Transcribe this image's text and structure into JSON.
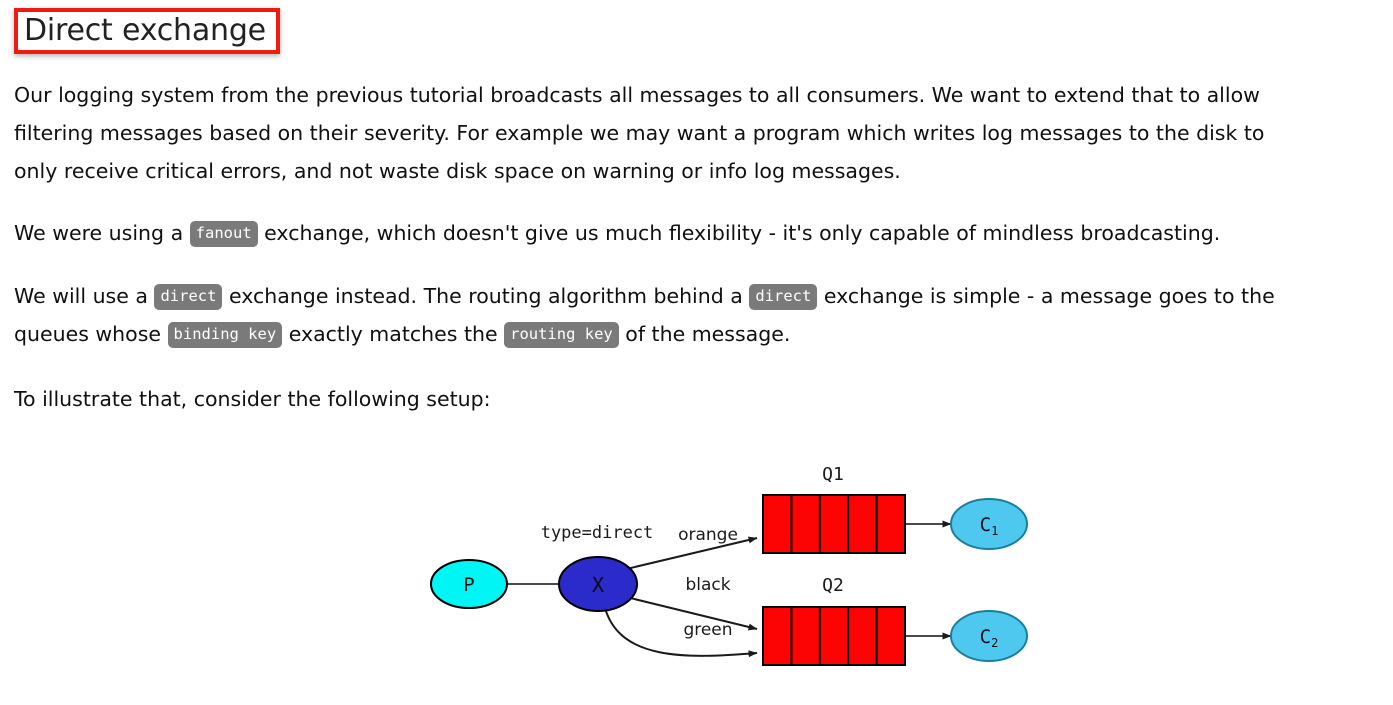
{
  "page": {
    "title": "Direct exchange",
    "title_highlight_color": "#ee1b11",
    "background": "#ffffff",
    "text_color": "#101010"
  },
  "paragraphs": [
    {
      "id": "p1",
      "lines": [
        "Our logging system from the previous tutorial broadcasts all messages to all consumers. We want to extend that to allow",
        "filtering messages based on their severity. For example we may want a program which writes log messages to the disk to",
        "only receive critical errors, and not waste disk space on warning or info log messages."
      ]
    },
    {
      "id": "p2",
      "segments": [
        {
          "type": "text",
          "value": "We were using a "
        },
        {
          "type": "code",
          "value": "fanout"
        },
        {
          "type": "text",
          "value": " exchange, which doesn't give us much flexibility - it's only capable of mindless broadcasting."
        }
      ]
    },
    {
      "id": "p3",
      "line1": [
        {
          "type": "text",
          "value": "We will use a "
        },
        {
          "type": "code",
          "value": "direct"
        },
        {
          "type": "text",
          "value": " exchange instead. The routing algorithm behind a "
        },
        {
          "type": "code",
          "value": "direct"
        },
        {
          "type": "text",
          "value": " exchange is simple - a message goes to the"
        }
      ],
      "line2": [
        {
          "type": "text",
          "value": "queues whose "
        },
        {
          "type": "code",
          "value": "binding key"
        },
        {
          "type": "text",
          "value": " exactly matches the "
        },
        {
          "type": "code",
          "value": "routing key"
        },
        {
          "type": "text",
          "value": " of the message."
        }
      ]
    },
    {
      "id": "p4",
      "lines": [
        "To illustrate that, consider the following setup:"
      ]
    }
  ],
  "code_style": {
    "background": "#7a7a7a",
    "color": "#ffffff"
  },
  "diagram": {
    "producer": {
      "label": "P",
      "fill": "#00f5f5",
      "stroke": "#000000"
    },
    "exchange": {
      "label": "X",
      "fill": "#2b2bcc",
      "stroke": "#000000",
      "type_label": "type=direct"
    },
    "queues": [
      {
        "label": "Q1",
        "fill": "#fc0404",
        "stroke": "#000000",
        "cells": 5
      },
      {
        "label": "Q2",
        "fill": "#fc0404",
        "stroke": "#000000",
        "cells": 5
      }
    ],
    "consumers": [
      {
        "label": "C",
        "sub": "1",
        "fill": "#4ec8ee",
        "stroke": "#1a7f9e"
      },
      {
        "label": "C",
        "sub": "2",
        "fill": "#4ec8ee",
        "stroke": "#1a7f9e"
      }
    ],
    "binding_keys": [
      "orange",
      "black",
      "green"
    ],
    "edge_color": "#333333"
  }
}
